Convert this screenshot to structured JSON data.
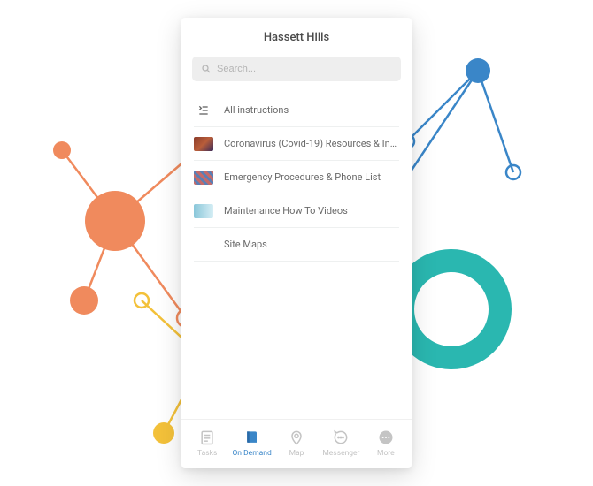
{
  "header": {
    "title": "Hassett Hills"
  },
  "search": {
    "placeholder": "Search..."
  },
  "list": {
    "items": [
      {
        "label": "All instructions",
        "icon": "list",
        "thumb": null
      },
      {
        "label": "Coronavirus (Covid-19) Resources & Infor...",
        "thumb": "t1"
      },
      {
        "label": "Emergency Procedures & Phone List",
        "thumb": "t2"
      },
      {
        "label": "Maintenance How To Videos",
        "thumb": "t3"
      },
      {
        "label": "Site Maps",
        "thumb": null
      }
    ]
  },
  "tabs": {
    "items": [
      {
        "label": "Tasks",
        "name": "tasks",
        "active": false
      },
      {
        "label": "On Demand",
        "name": "on-demand",
        "active": true
      },
      {
        "label": "Map",
        "name": "map",
        "active": false
      },
      {
        "label": "Messenger",
        "name": "messenger",
        "active": false
      },
      {
        "label": "More",
        "name": "more",
        "active": false
      }
    ]
  },
  "colors": {
    "accent": "#3a86c8",
    "bg_orange": "#f08a5d",
    "bg_teal": "#2ab7b0",
    "bg_blue": "#3a86c8",
    "bg_yellow": "#f3c13a"
  }
}
